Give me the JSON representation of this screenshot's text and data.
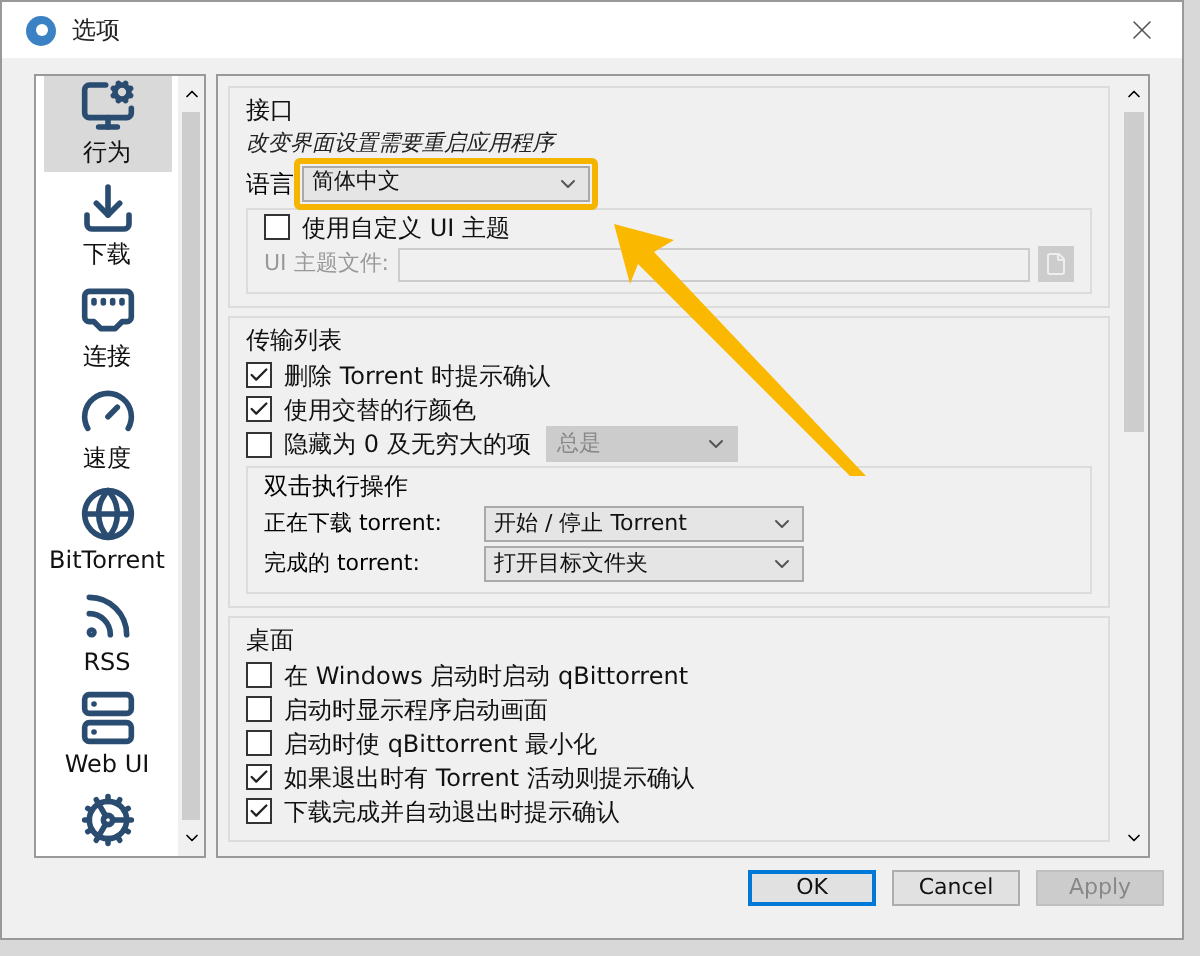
{
  "window": {
    "title": "选项"
  },
  "sidebar": {
    "items": [
      {
        "kind": "behavior",
        "label": "行为",
        "selected": true
      },
      {
        "kind": "download",
        "label": "下载",
        "selected": false
      },
      {
        "kind": "connection",
        "label": "连接",
        "selected": false
      },
      {
        "kind": "speed",
        "label": "速度",
        "selected": false
      },
      {
        "kind": "bittorrent",
        "label": "BitTorrent",
        "selected": false
      },
      {
        "kind": "rss",
        "label": "RSS",
        "selected": false
      },
      {
        "kind": "webui",
        "label": "Web UI",
        "selected": false
      },
      {
        "kind": "advanced",
        "selected": false
      }
    ]
  },
  "interface": {
    "title": "接口",
    "note": "改变界面设置需要重启应用程序",
    "language": {
      "label": "语言",
      "value": "简体中文",
      "highlighted": true
    },
    "custom_theme": {
      "label": "使用自定义 UI 主题",
      "checked": false,
      "file_label": "UI 主题文件:"
    }
  },
  "transfer_list": {
    "title": "传输列表",
    "checkboxes": [
      {
        "label": "删除 Torrent 时提示确认",
        "checked": true
      },
      {
        "label": "使用交替的行颜色",
        "checked": true
      }
    ],
    "hide_zero": {
      "label": "隐藏为 0 及无穷大的项",
      "checked": false,
      "value": "总是"
    },
    "double_click": {
      "title": "双击执行操作",
      "rows": [
        {
          "label": "正在下载 torrent:",
          "value": "开始 / 停止 Torrent"
        },
        {
          "label": "完成的 torrent:",
          "value": "打开目标文件夹"
        }
      ]
    }
  },
  "desktop": {
    "title": "桌面",
    "checkboxes": [
      {
        "label": "在 Windows 启动时启动 qBittorrent",
        "checked": false
      },
      {
        "label": "启动时显示程序启动画面",
        "checked": false
      },
      {
        "label": "启动时使 qBittorrent 最小化",
        "checked": false
      },
      {
        "label": "如果退出时有 Torrent 活动则提示确认",
        "checked": true
      },
      {
        "label": "下载完成并自动退出时提示确认",
        "checked": true
      }
    ]
  },
  "buttons": [
    {
      "label": "OK",
      "kind": "default"
    },
    {
      "label": "Cancel",
      "kind": "normal"
    },
    {
      "label": "Apply",
      "kind": "disabled"
    }
  ]
}
